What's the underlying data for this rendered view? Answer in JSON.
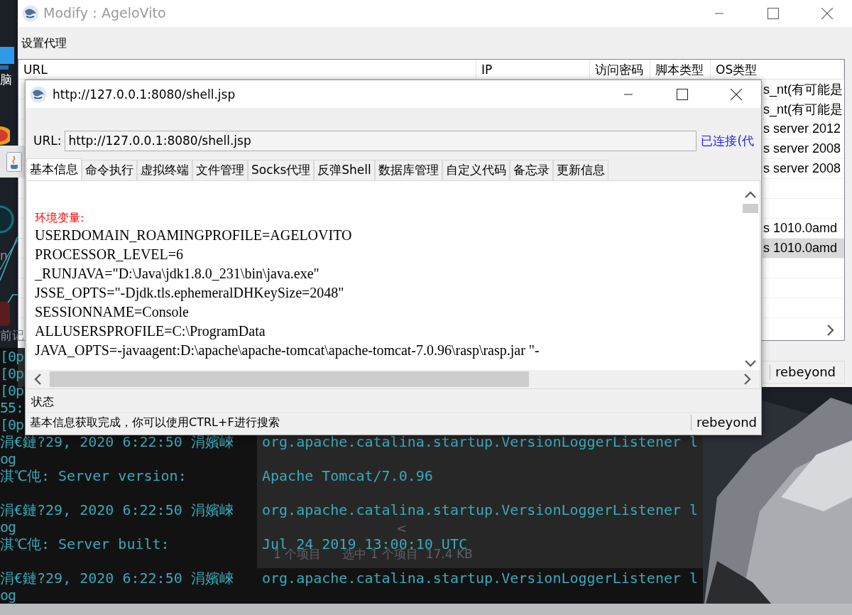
{
  "desktop": {
    "icons": [
      {
        "kind": "monitor",
        "label": "脑"
      },
      {
        "kind": "browser"
      },
      {
        "kind": "java_window"
      },
      {
        "kind": "ring",
        "label": "n"
      },
      {
        "kind": "red_tile",
        "label": "前记"
      }
    ]
  },
  "console": {
    "lines": [
      {
        "left": "[0p"
      },
      {
        "left": "[0p"
      },
      {
        "left": "[0p"
      },
      {
        "left": "55:"
      },
      {
        "left": "[0p"
      },
      {
        "left": "涓€鏈?29, 2020 6:22:50 涓嬪崍",
        "right": "org.apache.catalina.startup.VersionLoggerListener l"
      },
      {
        "left": "og"
      },
      {
        "left": "淇℃伅: Server version:",
        "right": "Apache Tomcat/7.0.96",
        "gap_after": true
      },
      {
        "left": "涓€鏈?29, 2020 6:22:50 涓嬪崍",
        "right": "org.apache.catalina.startup.VersionLoggerListener l"
      },
      {
        "left": "og"
      },
      {
        "left": "淇℃伅: Server built:",
        "right": "Jul 24 2019 13:00:10 UTC",
        "gap_after": true
      },
      {
        "left": "涓€鏈?29, 2020 6:22:50 涓嬪崍",
        "right": "org.apache.catalina.startup.VersionLoggerListener l"
      },
      {
        "left": "og"
      }
    ]
  },
  "explorer": {
    "scroll_arrow": "<",
    "status": [
      "1 个项目",
      "选中 1 个项目  17.4 KB"
    ]
  },
  "proxy_window": {
    "title": "Modify：AgeloVito",
    "section_label": "设置代理",
    "table": {
      "columns": [
        "URL",
        "IP",
        "访问密码",
        "脚本类型",
        "OS类型"
      ],
      "rows": [
        {
          "os": "s_nt(有可能是",
          "selected": false
        },
        {
          "os": "s_nt(有可能是",
          "selected": false
        },
        {
          "os": "s server 2012",
          "selected": false
        },
        {
          "os": "s server 2008",
          "selected": false
        },
        {
          "os": "s server 2008",
          "selected": false
        },
        {
          "selected": false
        },
        {
          "selected": false
        },
        {
          "os": "s 1010.0amd",
          "selected": false
        },
        {
          "os": "s 1010.0amd",
          "selected": true
        },
        {
          "selected": false
        },
        {
          "selected": false
        },
        {
          "selected": false
        }
      ]
    },
    "status_right": "rebeyond"
  },
  "shell_window": {
    "title": "http://127.0.0.1:8080/shell.jsp",
    "url_label": "URL:",
    "url": "http://127.0.0.1:8080/shell.jsp",
    "connection": "已连接(代",
    "tabs": [
      {
        "label": "基本信息",
        "selected": true
      },
      {
        "label": "命令执行",
        "selected": false
      },
      {
        "label": "虚拟终端",
        "selected": false
      },
      {
        "label": "文件管理",
        "selected": false
      },
      {
        "label": "Socks代理",
        "selected": false
      },
      {
        "label": "反弹Shell",
        "selected": false
      },
      {
        "label": "数据库管理",
        "selected": false
      },
      {
        "label": "自定义代码",
        "selected": false
      },
      {
        "label": "备忘录",
        "selected": false
      },
      {
        "label": "更新信息",
        "selected": false
      }
    ],
    "content": {
      "heading": "环境变量:",
      "lines": [
        "USERDOMAIN_ROAMINGPROFILE=AGELOVITO",
        "PROCESSOR_LEVEL=6",
        "_RUNJAVA=\"D:\\Java\\jdk1.8.0_231\\bin\\java.exe\"",
        "JSSE_OPTS=\"-Djdk.tls.ephemeralDHKeySize=2048\"",
        "SESSIONNAME=Console",
        "ALLUSERSPROFILE=C:\\ProgramData",
        "JAVA_OPTS=-javaagent:D:\\apache\\apache-tomcat\\apache-tomcat-7.0.96\\rasp\\rasp.jar \"-"
      ]
    },
    "status_label": "状态",
    "status_message": "基本信息获取完成，你可以使用CTRL+F进行搜索",
    "status_right": "rebeyond"
  }
}
